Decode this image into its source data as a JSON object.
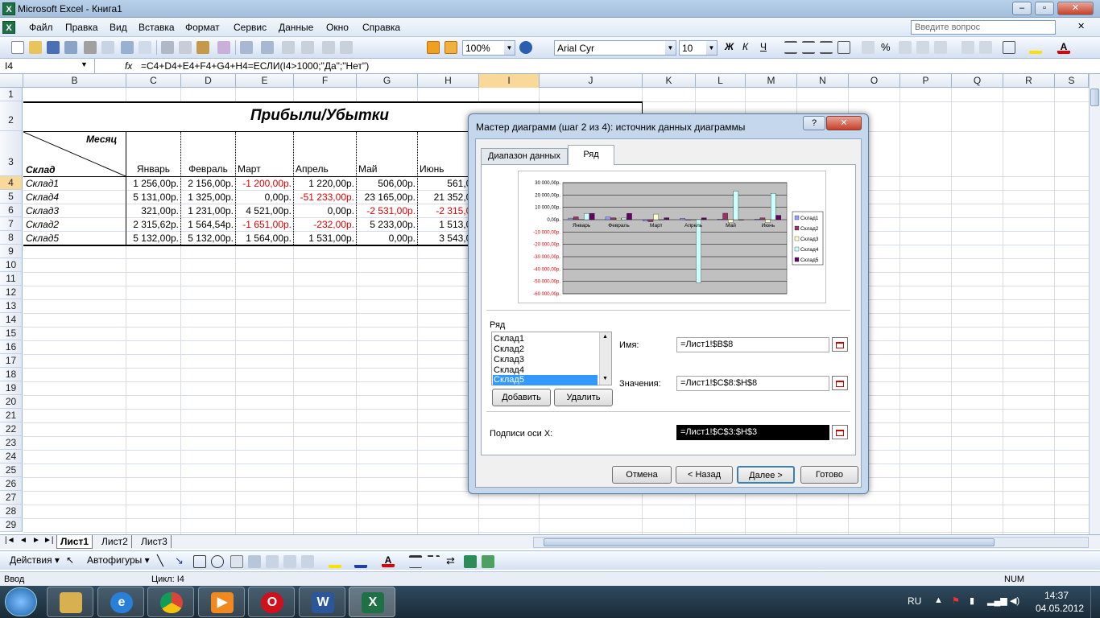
{
  "window": {
    "title": "Microsoft Excel - Книга1"
  },
  "menu": {
    "items": [
      "Файл",
      "Правка",
      "Вид",
      "Вставка",
      "Формат",
      "Сервис",
      "Данные",
      "Окно",
      "Справка"
    ],
    "ask_placeholder": "Введите вопрос"
  },
  "toolbar": {
    "zoom": "100%",
    "font": "Arial Cyr",
    "font_size": "10"
  },
  "formula_bar": {
    "name_box": "I4",
    "fx": "fx",
    "formula": "=C4+D4+E4+F4+G4+H4=ЕСЛИ(I4>1000;\"Да\";\"Нет\")"
  },
  "columns": [
    "B",
    "C",
    "D",
    "E",
    "F",
    "G",
    "H",
    "I",
    "J",
    "K",
    "L",
    "M",
    "N",
    "O",
    "P",
    "Q",
    "R",
    "S"
  ],
  "rows": [
    "1",
    "2",
    "3",
    "4",
    "5",
    "6",
    "7",
    "8",
    "9",
    "10",
    "11",
    "12",
    "13",
    "14",
    "15",
    "16",
    "17",
    "18",
    "19",
    "20",
    "21",
    "22",
    "23",
    "24",
    "25",
    "26",
    "27",
    "28",
    "29"
  ],
  "sheet": {
    "title": "Прибыли/Убытки",
    "corner_top": "Месяц",
    "corner_bottom": "Склад",
    "months": [
      "Январь",
      "Февраль",
      "Март",
      "Апрель",
      "Май",
      "Июнь"
    ],
    "table": [
      {
        "name": "Склад1",
        "values": [
          "1 256,00р.",
          "2 156,00р.",
          "-1 200,00р.",
          "1 220,00р.",
          "506,00р.",
          "561,00"
        ]
      },
      {
        "name": "Склад4",
        "values": [
          "5 131,00р.",
          "1 325,00р.",
          "0,00р.",
          "-51 233,00р.",
          "23 165,00р.",
          "21 352,00"
        ]
      },
      {
        "name": "Склад3",
        "values": [
          "321,00р.",
          "1 231,00р.",
          "4 521,00р.",
          "0,00р.",
          "-2 531,00р.",
          "-2 315,00"
        ]
      },
      {
        "name": "Склад2",
        "values": [
          "2 315,62р.",
          "1 564,54р.",
          "-1 651,00р.",
          "-232,00р.",
          "5 233,00р.",
          "1 513,00"
        ]
      },
      {
        "name": "Склад5",
        "values": [
          "5 132,00р.",
          "5 132,00р.",
          "1 564,00р.",
          "1 531,00р.",
          "0,00р.",
          "3 543,00"
        ]
      }
    ]
  },
  "sheet_tabs": [
    "Лист1",
    "Лист2",
    "Лист3"
  ],
  "draw_toolbar": {
    "actions": "Действия",
    "autoshapes": "Автофигуры"
  },
  "status": {
    "mode": "Ввод",
    "cycle": "Цикл: I4",
    "num": "NUM"
  },
  "taskbar": {
    "lang": "RU",
    "time": "14:37",
    "date": "04.05.2012"
  },
  "dialog": {
    "title": "Мастер диаграмм (шаг 2 из 4): источник данных диаграммы",
    "help": "?",
    "close": "✕",
    "tab_range": "Диапазон данных",
    "tab_series": "Ряд",
    "series_label": "Ряд",
    "series_list": [
      "Склад1",
      "Склад2",
      "Склад3",
      "Склад4",
      "Склад5"
    ],
    "selected_series": "Склад5",
    "add": "Добавить",
    "remove": "Удалить",
    "name_label": "Имя:",
    "name_value": "=Лист1!$B$8",
    "values_label": "Значения:",
    "values_value": "=Лист1!$C$8:$H$8",
    "xlabels_label": "Подписи оси X:",
    "xlabels_value": "=Лист1!$C$3:$H$3",
    "cancel": "Отмена",
    "back": "< Назад",
    "next": "Далее >",
    "finish": "Готово"
  },
  "chart_data": {
    "type": "bar",
    "categories": [
      "Январь",
      "Февраль",
      "Март",
      "Апрель",
      "Май",
      "Июнь"
    ],
    "series": [
      {
        "name": "Склад1",
        "values": [
          1256,
          2156,
          -1200,
          1220,
          506,
          561
        ],
        "color": "#9999ff"
      },
      {
        "name": "Склад2",
        "values": [
          2315.62,
          1564.54,
          -1651,
          -232,
          5233,
          1513
        ],
        "color": "#993366"
      },
      {
        "name": "Склад3",
        "values": [
          321,
          1231,
          4521,
          0,
          -2531,
          -2315
        ],
        "color": "#ffffcc"
      },
      {
        "name": "Склад4",
        "values": [
          5131,
          1325,
          0,
          -51233,
          23165,
          21352
        ],
        "color": "#ccffff"
      },
      {
        "name": "Склад5",
        "values": [
          5132,
          5132,
          1564,
          1531,
          0,
          3543
        ],
        "color": "#660066"
      }
    ],
    "ylim": [
      -60000,
      30000
    ],
    "yticks": [
      "30 000,00р.",
      "20 000,00р.",
      "10 000,00р.",
      "0,00р.",
      "-10 000,00р.",
      "-20 000,00р.",
      "-30 000,00р.",
      "-40 000,00р.",
      "-50 000,00р.",
      "-60 000,00р."
    ],
    "grid": true,
    "legend": "right",
    "plot_bg": "#c0c0c0"
  }
}
